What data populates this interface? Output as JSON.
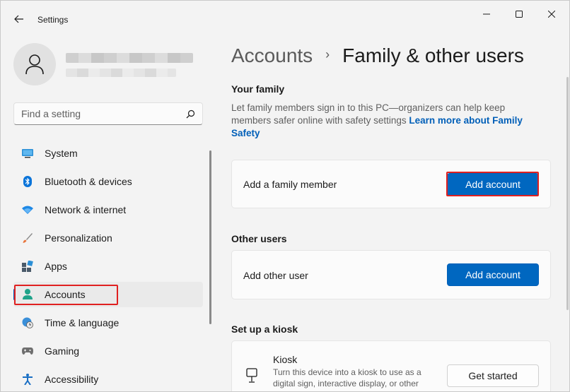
{
  "window": {
    "title": "Settings",
    "controls": {
      "minimize": "minimize",
      "maximize": "maximize",
      "close": "close"
    }
  },
  "sidebar": {
    "search": {
      "placeholder": "Find a setting",
      "value": ""
    },
    "items": [
      {
        "label": "System",
        "icon": "monitor-icon",
        "active": false
      },
      {
        "label": "Bluetooth & devices",
        "icon": "bluetooth-icon",
        "active": false
      },
      {
        "label": "Network & internet",
        "icon": "wifi-icon",
        "active": false
      },
      {
        "label": "Personalization",
        "icon": "brush-icon",
        "active": false
      },
      {
        "label": "Apps",
        "icon": "apps-icon",
        "active": false
      },
      {
        "label": "Accounts",
        "icon": "person-icon",
        "active": true
      },
      {
        "label": "Time & language",
        "icon": "globe-clock-icon",
        "active": false
      },
      {
        "label": "Gaming",
        "icon": "gamepad-icon",
        "active": false
      },
      {
        "label": "Accessibility",
        "icon": "accessibility-icon",
        "active": false
      }
    ]
  },
  "breadcrumb": {
    "parent": "Accounts",
    "separator": "›",
    "current": "Family & other users"
  },
  "family": {
    "heading": "Your family",
    "description": "Let family members sign in to this PC—organizers can help keep members safer online with safety settings",
    "link": "Learn more about Family Safety",
    "card_label": "Add a family member",
    "button": "Add account"
  },
  "other_users": {
    "heading": "Other users",
    "card_label": "Add other user",
    "button": "Add account"
  },
  "kiosk": {
    "heading": "Set up a kiosk",
    "title": "Kiosk",
    "description": "Turn this device into a kiosk to use as a digital sign, interactive display, or other",
    "button": "Get started"
  },
  "colors": {
    "accent": "#0067c0",
    "highlight": "#e02020",
    "link": "#005fb8"
  }
}
